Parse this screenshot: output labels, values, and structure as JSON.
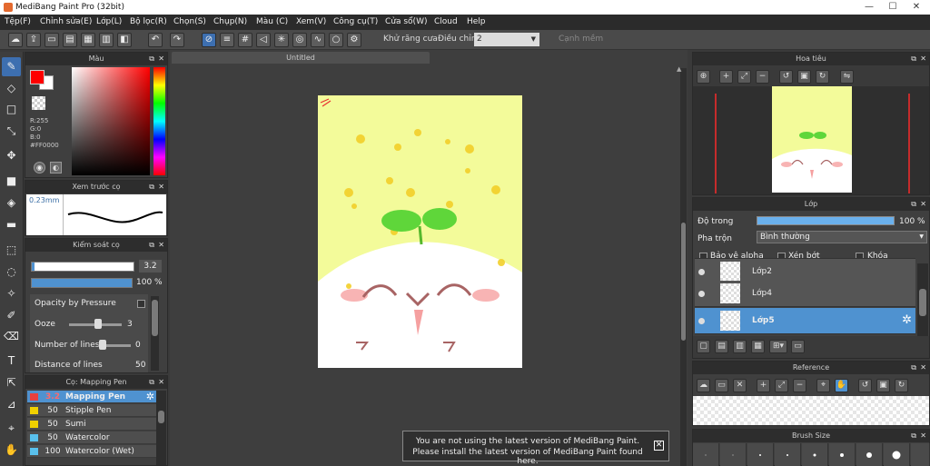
{
  "window": {
    "title": "MediBang Paint Pro (32bit)",
    "controls": [
      "—",
      "☐",
      "✕"
    ]
  },
  "menu": [
    "Tệp(F)",
    "Chỉnh sửa(E)",
    "Lớp(L)",
    "Bộ lọc(R)",
    "Chọn(S)",
    "Chụp(N)",
    "Màu (C)",
    "Xem(V)",
    "Công cụ(T)",
    "Cửa sổ(W)",
    "Cloud",
    "Help"
  ],
  "toolbar": {
    "antialias_label": "Khử răng cưa",
    "adjust_label": "Điều chỉnh",
    "adjust_value": "2",
    "smooth_edge_label": "Cạnh mềm"
  },
  "color_panel": {
    "title": "Màu",
    "r": "R:255",
    "g": "G:0",
    "b": "B:0",
    "hex": "#FF0000",
    "fg_color": "#FF0000",
    "bg_color": "#FFFFFF"
  },
  "brush_preview": {
    "title": "Xem trước cọ",
    "size": "0.23mm"
  },
  "brush_control": {
    "title": "Kiểm soát cọ",
    "size_value": "3.2",
    "opacity_value": "100 %",
    "opacity_by_pressure": "Opacity by Pressure",
    "ooze_label": "Ooze",
    "ooze_value": "3",
    "lines_label": "Number of lines",
    "lines_value": "0",
    "distance_label": "Distance of lines",
    "distance_value": "50"
  },
  "brush_list": {
    "title": "Cọ: Mapping Pen",
    "items": [
      {
        "size": "3.2",
        "name": "Mapping Pen",
        "color": "#e84040",
        "selected": true
      },
      {
        "size": "50",
        "name": "Stipple Pen",
        "color": "#f0d000",
        "selected": false
      },
      {
        "size": "50",
        "name": "Sumi",
        "color": "#f0d000",
        "selected": false
      },
      {
        "size": "50",
        "name": "Watercolor",
        "color": "#59c0ec",
        "selected": false
      },
      {
        "size": "100",
        "name": "Watercolor (Wet)",
        "color": "#59c0ec",
        "selected": false
      }
    ]
  },
  "document": {
    "tab_title": "Untitled"
  },
  "navigator": {
    "title": "Hoa tiêu"
  },
  "layer_panel": {
    "title": "Lớp",
    "opacity_label": "Độ trong",
    "opacity_value": "100 %",
    "blend_label": "Pha trộn",
    "blend_value": "Bình thường",
    "protect_alpha": "Bảo vệ alpha",
    "clipping": "Xén bớt",
    "lock": "Khóa",
    "layers": [
      {
        "name": "Lớp2",
        "selected": false
      },
      {
        "name": "Lớp4",
        "selected": false
      },
      {
        "name": "Lớp5",
        "selected": true
      }
    ]
  },
  "reference": {
    "title": "Reference"
  },
  "brush_size": {
    "title": "Brush Size"
  },
  "notice": {
    "line1": "You are not using the latest version of MediBang Paint.",
    "line2": "Please install the latest version of MediBang Paint found here."
  },
  "colors": {
    "accent": "#4f92d0",
    "panel": "#3f3f3f",
    "canvas_bg": "#f3fb9a"
  }
}
